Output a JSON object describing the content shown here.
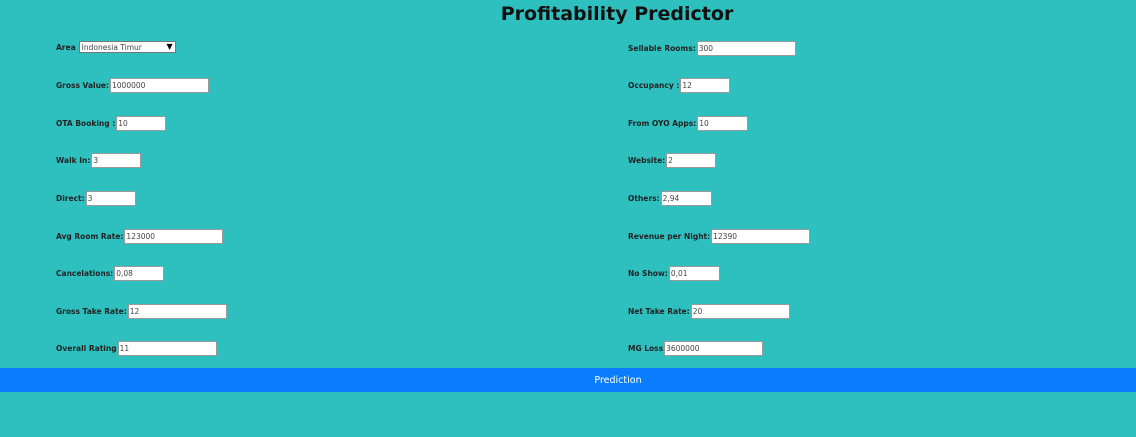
{
  "title": "Profitability Predictor",
  "area": {
    "label": "Area",
    "selected": "Indonesia Timur"
  },
  "left_fields": [
    {
      "key": "gross_value",
      "label": "Gross Value:",
      "value": "1000000"
    },
    {
      "key": "ota_booking",
      "label": "OTA Booking :",
      "value": "10"
    },
    {
      "key": "walk_in",
      "label": "Walk In:",
      "value": "3"
    },
    {
      "key": "direct",
      "label": "Direct:",
      "value": "3"
    },
    {
      "key": "avg_room_rate",
      "label": "Avg Room Rate:",
      "value": "123000"
    },
    {
      "key": "cancelations",
      "label": "Cancelations:",
      "value": "0,08"
    },
    {
      "key": "gross_take_rate",
      "label": "Gross Take Rate:",
      "value": "12"
    },
    {
      "key": "overall_rating",
      "label": "Overall Rating",
      "value": "11"
    }
  ],
  "right_fields": [
    {
      "key": "sellable_rooms",
      "label": "Sellable Rooms:",
      "value": "300"
    },
    {
      "key": "occupancy",
      "label": "Occupancy :",
      "value": "12"
    },
    {
      "key": "from_oyo_apps",
      "label": "From OYO Apps:",
      "value": "10"
    },
    {
      "key": "website",
      "label": "Website:",
      "value": "2"
    },
    {
      "key": "others",
      "label": "Others:",
      "value": "2,94"
    },
    {
      "key": "revenue_per_night",
      "label": "Revenue per Night:",
      "value": "12390"
    },
    {
      "key": "no_show",
      "label": "No Show:",
      "value": "0,01"
    },
    {
      "key": "net_take_rate",
      "label": "Net Take Rate:",
      "value": "20"
    },
    {
      "key": "mg_loss",
      "label": "MG Loss",
      "value": "3600000"
    }
  ],
  "prediction_label": "Prediction"
}
